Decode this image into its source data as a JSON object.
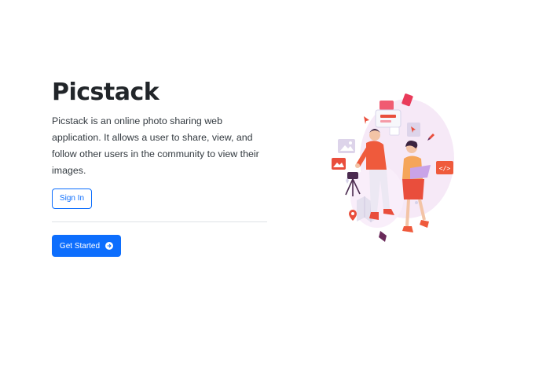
{
  "hero": {
    "title": "Picstack",
    "description": "Picstack is an online photo sharing web application. It allows a user to share, view, and follow other users in the community to view their images."
  },
  "buttons": {
    "sign_in": "Sign In",
    "get_started": "Get Started"
  },
  "colors": {
    "primary": "#0d6efd",
    "title": "#212529",
    "illustration_accent": "#ef5a3c",
    "illustration_background": "#f6e9f7"
  },
  "icons": {
    "get_started_arrow": "arrow-right-circle-icon",
    "illustration": "photographer-illustration"
  }
}
